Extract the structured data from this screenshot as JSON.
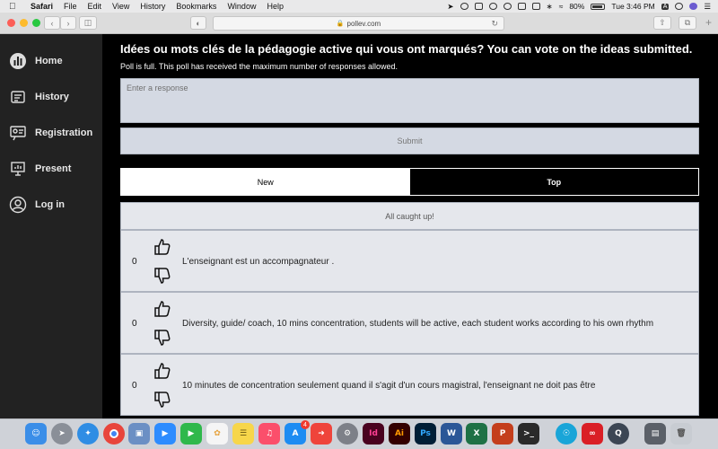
{
  "menubar": {
    "app": "Safari",
    "menus": [
      "File",
      "Edit",
      "View",
      "History",
      "Bookmarks",
      "Window",
      "Help"
    ],
    "battery": "80%",
    "clock": "Tue 3:46 PM",
    "input_source": "A"
  },
  "browser": {
    "url": "pollev.com"
  },
  "sidebar": {
    "items": [
      {
        "label": "Home",
        "icon": "bar-chart-icon"
      },
      {
        "label": "History",
        "icon": "history-icon"
      },
      {
        "label": "Registration",
        "icon": "registration-icon"
      },
      {
        "label": "Present",
        "icon": "present-icon"
      },
      {
        "label": "Log in",
        "icon": "user-icon"
      }
    ]
  },
  "poll": {
    "title": "Idées ou mots clés de la pédagogie active qui vous ont marqués? You can vote on the ideas submitted.",
    "status": "Poll is full. This poll has received the maximum number of responses allowed.",
    "response_placeholder": "Enter a response",
    "submit_label": "Submit",
    "tabs": [
      {
        "label": "New",
        "active": true
      },
      {
        "label": "Top",
        "active": false
      }
    ],
    "caught_up": "All caught up!",
    "ideas": [
      {
        "votes": "0",
        "text": "L'enseignant est un accompagnateur ."
      },
      {
        "votes": "0",
        "text": "Diversity, guide/ coach, 10 mins concentration, students will be active, each student works according to his own rhythm"
      },
      {
        "votes": "0",
        "text": "10 minutes de concentration seulement quand il s'agit d'un cours magistral, l'enseignant ne doit pas être"
      }
    ]
  },
  "dock": {
    "badge": "4",
    "apps": [
      "Finder",
      "Launchpad",
      "Safari",
      "Chrome",
      "Preview",
      "Zoom",
      "FaceTime",
      "Photos",
      "Notes",
      "Music",
      "App Store",
      "Anydesk",
      "System Preferences",
      "InDesign",
      "Illustrator",
      "Photoshop",
      "Word",
      "Excel",
      "PowerPoint",
      "Terminal",
      "Accessibility",
      "Creative Cloud",
      "QuickTime",
      "Files",
      "Trash"
    ]
  }
}
